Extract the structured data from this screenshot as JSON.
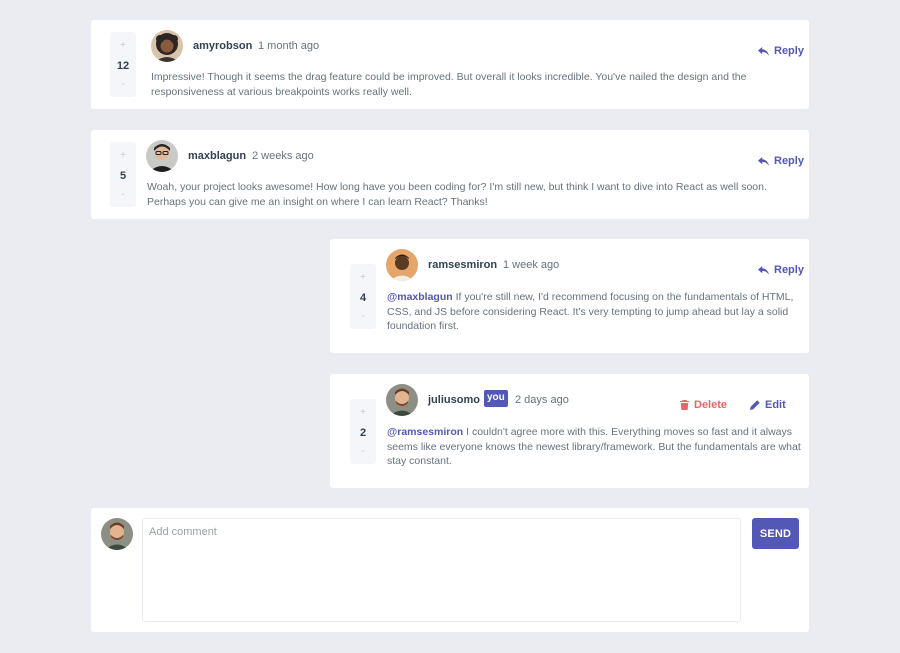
{
  "colors": {
    "background": "#eaecf1",
    "card": "#ffffff",
    "accent": "#5357b6",
    "danger": "#ed6468",
    "vote_bg": "#f5f6fa",
    "heading": "#324152",
    "body_text": "#67727e"
  },
  "comments": [
    {
      "username": "amyrobson",
      "time": "1 month ago",
      "score": "12",
      "text": "Impressive! Though it seems the drag feature could be improved. But overall it looks incredible. You've nailed the design and the responsiveness at various breakpoints works really well.",
      "action_label": "Reply",
      "icon": "reply-icon"
    },
    {
      "username": "maxblagun",
      "time": "2 weeks ago",
      "score": "5",
      "text": "Woah, your project looks awesome! How long have you been coding for? I'm still new, but think I want to dive into React as well soon. Perhaps you can give me an insight on where I can learn React? Thanks!",
      "action_label": "Reply",
      "icon": "reply-icon"
    }
  ],
  "replies": [
    {
      "username": "ramsesmiron",
      "time": "1 week ago",
      "score": "4",
      "mention": "@maxblagun",
      "text": " If you're still new, I'd recommend focusing on the fundamentals of HTML, CSS, and JS before considering React. It's very tempting to jump ahead but lay a solid foundation first.",
      "action_label": "Reply",
      "icon": "reply-icon"
    },
    {
      "username": "juliusomo",
      "badge": "you",
      "time": "2 days ago",
      "score": "2",
      "mention": "@ramsesmiron",
      "text": " I couldn't agree more with this. Everything moves so fast and it always seems like everyone knows the newest library/framework. But the fundamentals are what stay constant.",
      "delete_label": "Delete",
      "edit_label": "Edit"
    }
  ],
  "vote": {
    "plus": "+",
    "minus": "-"
  },
  "composer": {
    "placeholder": "Add comment",
    "value": "",
    "send_label": "SEND"
  }
}
